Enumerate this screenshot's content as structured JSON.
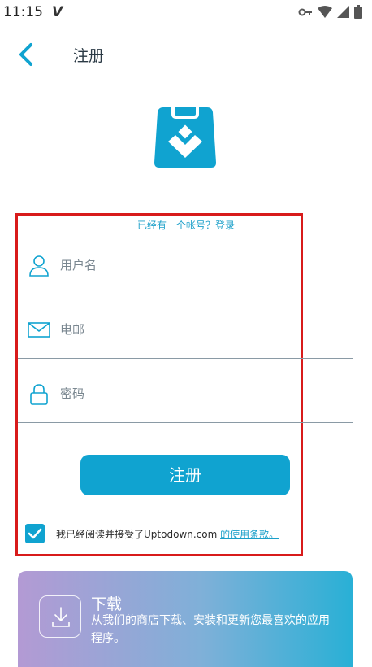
{
  "status_bar": {
    "time": "11:15",
    "notification_letter": "V"
  },
  "header": {
    "title": "注册"
  },
  "login_prompt": "已经有一个帐号？登录",
  "form": {
    "username_placeholder": "用户名",
    "email_placeholder": "电邮",
    "password_placeholder": "密码"
  },
  "register_button": "注册",
  "terms": {
    "checked": true,
    "text": "我已经阅读并接受了Uptodown.com ",
    "link": "的使用条款。"
  },
  "download_card": {
    "title": "下载",
    "description": "从我们的商店下载、安装和更新您最喜欢的应用程序。"
  },
  "colors": {
    "accent": "#10a3d0",
    "frame": "#d81b1b"
  }
}
